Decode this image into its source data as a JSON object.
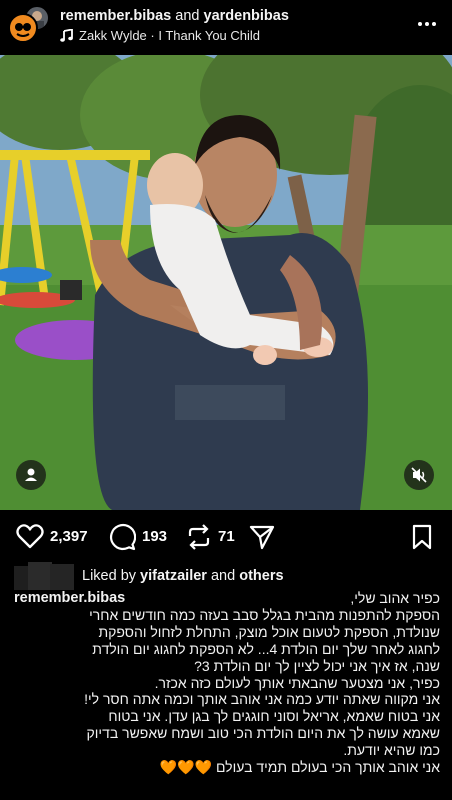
{
  "header": {
    "user1": "remember.bibas",
    "joiner": "and",
    "user2": "yardenbibas",
    "song": "Zakk Wylde · I Thank You Child"
  },
  "counts": {
    "likes": "2,397",
    "comments": "193",
    "reposts": "71"
  },
  "liked_by": {
    "prefix": "Liked by",
    "user": "yifatzailer",
    "conj": "and",
    "rest": "others"
  },
  "caption": {
    "username": "remember.bibas",
    "lines": [
      "כפיר אהוב שלי,",
      "הספקת להתפנות מהבית בגלל סבב בעזה כמה חודשים אחרי",
      "שנולדת, הספקת לטעום אוכל מוצק, התחלת לזחול והספקת",
      "לחגוג לאחר שלך יום הולדת 4... לא הספקת לחגוג יום הולדת",
      "שנה, אז איך אני יכול לציין לך יום הולדת 3?",
      "כפיר, אני מצטער שהבאתי אותך לעולם כזה אכזר.",
      "אני מקווה שאתה יודע כמה אני אוהב אותך וכמה אתה חסר לי!",
      "אני בטוח שאמא, אריאל וסוני חוגגים לך בגן עדן. אני בטוח",
      "שאמא עושה לך את היום הולדת הכי טוב ושמח שאפשר בדיוק",
      "כמו שהיא יודעת.",
      "אני אוהב אותך הכי בעולם תמיד בעולם 🧡🧡🧡"
    ]
  },
  "colors": {
    "background": "#000000",
    "text": "#f5f5f5",
    "heart": "#f2a23a"
  },
  "icons": [
    "music-note-icon",
    "more-options-icon",
    "user-tag-icon",
    "muted-speaker-icon",
    "heart-icon",
    "comment-icon",
    "repost-icon",
    "share-icon",
    "bookmark-icon"
  ]
}
